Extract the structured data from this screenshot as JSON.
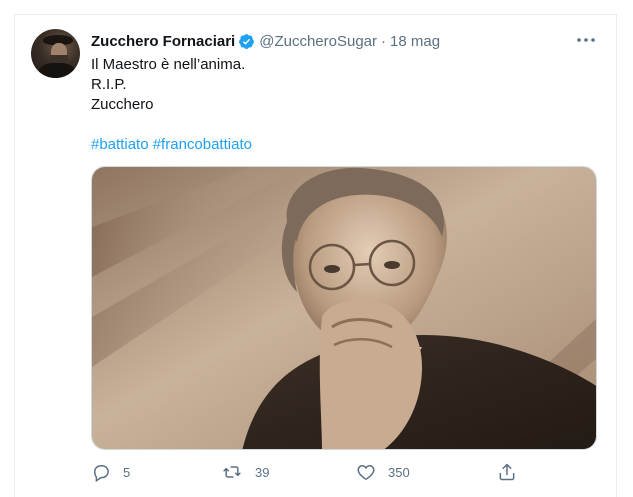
{
  "tweet": {
    "display_name": "Zucchero Fornaciari",
    "handle": "@ZuccheroSugar",
    "separator": "·",
    "date": "18 mag",
    "lines": [
      "Il Maestro è nell’anima.",
      "R.I.P.",
      "Zucchero"
    ],
    "hashtags": [
      "#battiato",
      "#francobattiato"
    ],
    "verified": true
  },
  "actions": {
    "reply_count": "5",
    "retweet_count": "39",
    "like_count": "350"
  },
  "colors": {
    "link": "#1da1f2",
    "secondary_text": "#5b7083",
    "verified_badge": "#1da1f2"
  },
  "icons": [
    "more-icon",
    "verified-badge-icon",
    "reply-icon",
    "retweet-icon",
    "like-icon",
    "share-icon"
  ]
}
